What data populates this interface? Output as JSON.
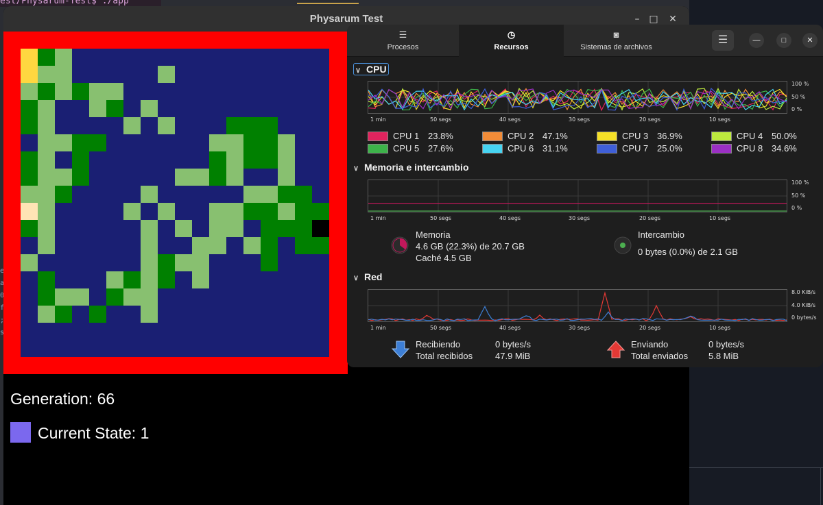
{
  "background": {
    "terminal_prompt": "est/Physarum-Test$ ./app",
    "left_strip_chars": [
      "e",
      "a",
      "0",
      "f",
      ";",
      "s"
    ]
  },
  "physarum_window": {
    "title": "Physarum Test",
    "controls": {
      "minimize": "–",
      "maximize": "□",
      "close": "✕"
    },
    "grid": {
      "size": 18,
      "colors": {
        "0": "#1a1f73",
        "1": "#008000",
        "2": "#88c070",
        "3": "#ffd740",
        "4": "#ffe4b5",
        "5": "#000000"
      },
      "cells": [
        "312000000000000000",
        "322000002000000000",
        "212122000000000000",
        "120021020000000000",
        "120000202000111000",
        "022110000002211200",
        "120100000001211200",
        "122100000221200200",
        "221000020000022110",
        "420000202002211211",
        "120000020202201115",
        "020000020022021011",
        "200000021220001000",
        "010002121020000000",
        "012201220000000000",
        "021010020000000000",
        "000000000000000000",
        "000000000000000000"
      ]
    },
    "generation_label": "Generation: 66",
    "current_state_label": "Current State: 1",
    "current_state_color": "#7b68ee"
  },
  "system_monitor": {
    "tabs": [
      {
        "label": "Procesos",
        "icon": "☰"
      },
      {
        "label": "Recursos",
        "icon": "◷"
      },
      {
        "label": "Sistemas de archivos",
        "icon": "◙"
      }
    ],
    "menu_icon": "☰",
    "window_controls": {
      "minimize": "—",
      "maximize": "□",
      "close": "✕"
    },
    "time_ticks": [
      "1 min",
      "50 segs",
      "40 segs",
      "30 segs",
      "20 segs",
      "10 segs"
    ],
    "cpu": {
      "title": "CPU",
      "percent_labels": [
        "100 %",
        "50 %",
        "0 %"
      ],
      "cores": [
        {
          "name": "CPU 1",
          "value": "23.8%",
          "color": "#e0245e"
        },
        {
          "name": "CPU 2",
          "value": "47.1%",
          "color": "#f28c38"
        },
        {
          "name": "CPU 3",
          "value": "36.9%",
          "color": "#f5e027"
        },
        {
          "name": "CPU 4",
          "value": "50.0%",
          "color": "#bdea3e"
        },
        {
          "name": "CPU 5",
          "value": "27.6%",
          "color": "#3db34a"
        },
        {
          "name": "CPU 6",
          "value": "31.1%",
          "color": "#46d4f2"
        },
        {
          "name": "CPU 7",
          "value": "25.0%",
          "color": "#3f5fd8"
        },
        {
          "name": "CPU 8",
          "value": "34.6%",
          "color": "#9b2fc4"
        }
      ]
    },
    "memory": {
      "title": "Memoria e intercambio",
      "percent_labels": [
        "100 %",
        "50 %",
        "0 %"
      ],
      "mem_label": "Memoria",
      "mem_value": "4.6 GB (22.3%) de 20.7 GB",
      "cache_value": "Caché 4.5 GB",
      "swap_label": "Intercambio",
      "swap_value": "0 bytes (0.0%) de 2.1 GB",
      "mem_color": "#c2185b",
      "swap_color": "#4caf50"
    },
    "network": {
      "title": "Red",
      "rate_labels": [
        "8.0 KiB/s",
        "4.0 KiB/s",
        "0 bytes/s"
      ],
      "receiving_label": "Recibiendo",
      "receiving_value": "0 bytes/s",
      "total_received_label": "Total recibidos",
      "total_received_value": "47.9 MiB",
      "sending_label": "Enviando",
      "sending_value": "0 bytes/s",
      "total_sent_label": "Total enviados",
      "total_sent_value": "5.8 MiB",
      "receive_color": "#3d7fd6",
      "send_color": "#e53935"
    }
  }
}
